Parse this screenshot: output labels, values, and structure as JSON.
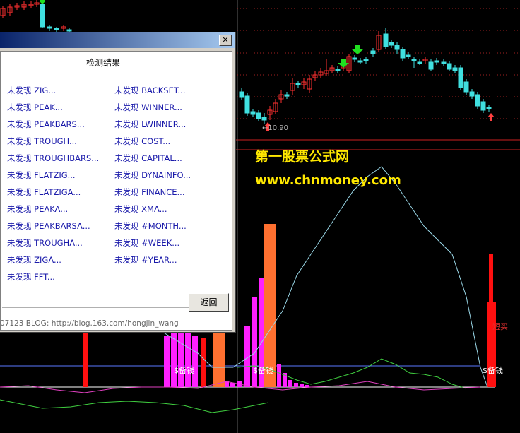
{
  "watermark": {
    "line1": "第一股票公式网",
    "line2": "www.chnmoney.com"
  },
  "price_label": "←10.90",
  "indicator_labels": {
    "label_a": "$备钱",
    "label_b": "$备钱",
    "label_c": "$备钱",
    "buy_mark": "短买"
  },
  "dialog": {
    "title": "",
    "close_glyph": "✕",
    "panel_title": "检测结果",
    "left_items": [
      "未发现 ZIG...",
      "未发现 PEAK...",
      "未发现 PEAKBARS...",
      "未发现 TROUGH...",
      "未发现 TROUGHBARS...",
      "未发现 FLATZIG...",
      "未发现 FLATZIGA...",
      "未发现 PEAKA...",
      "未发现 PEAKBARSA...",
      "未发现 TROUGHA...",
      "未发现 ZIGA...",
      "未发现 FFT..."
    ],
    "right_items": [
      "未发现 BACKSET...",
      "未发现 WINNER...",
      "未发现 LWINNER...",
      "未发现 COST...",
      "未发现 CAPITAL...",
      "未发现 DYNAINFO...",
      "未发现 FINANCE...",
      "未发现 XMA...",
      "未发现 #MONTH...",
      "未发现 #WEEK...",
      "未发现 #YEAR..."
    ],
    "back_button": "返回",
    "status_text": "07123  BLOG: http://blog.163.com/hongjin_wang"
  },
  "colors": {
    "bull": "#ff3030",
    "bear": "#40e0e0",
    "magenta": "#ff20ff",
    "orange": "#ff7030",
    "red_bar": "#ff1010",
    "cyan_line": "#9ad8e8",
    "green_line": "#40d040",
    "pink_line": "#e040c0"
  }
}
